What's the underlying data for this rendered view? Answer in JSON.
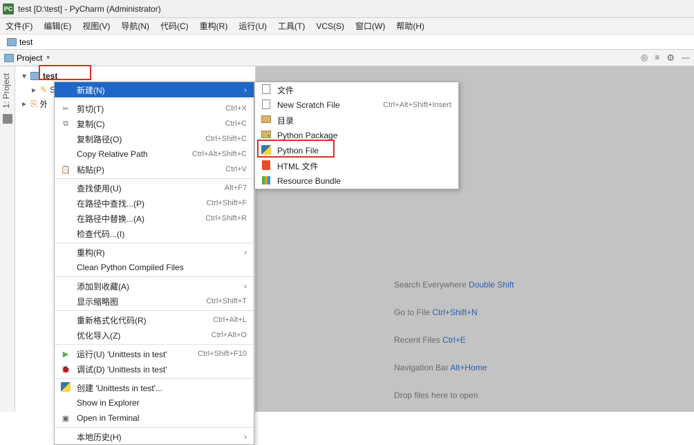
{
  "title": "test [D:\\test] - PyCharm (Administrator)",
  "menubar": [
    "文件(F)",
    "编辑(E)",
    "视图(V)",
    "导航(N)",
    "代码(C)",
    "重构(R)",
    "运行(U)",
    "工具(T)",
    "VCS(S)",
    "窗口(W)",
    "帮助(H)"
  ],
  "breadcrumb": "test",
  "projectPane": {
    "title": "Project"
  },
  "sideTab": {
    "label": "1: Project"
  },
  "tree": {
    "root": {
      "name": "test",
      "path": "D:\\test"
    },
    "scratches": "Scratches and Consoles",
    "external": "外部库"
  },
  "ctx": [
    {
      "ic": "",
      "lbl": "新建(N)",
      "sub": "›",
      "sel": true
    },
    {
      "sep": true
    },
    {
      "ic": "✂",
      "lbl": "剪切(T)",
      "sc": "Ctrl+X"
    },
    {
      "ic": "⧉",
      "lbl": "复制(C)",
      "sc": "Ctrl+C"
    },
    {
      "ic": "",
      "lbl": "复制路径(O)",
      "sc": "Ctrl+Shift+C"
    },
    {
      "ic": "",
      "lbl": "Copy Relative Path",
      "sc": "Ctrl+Alt+Shift+C"
    },
    {
      "ic": "📋",
      "lbl": "粘贴(P)",
      "sc": "Ctrl+V"
    },
    {
      "sep": true
    },
    {
      "ic": "",
      "lbl": "查找使用(U)",
      "sc": "Alt+F7"
    },
    {
      "ic": "",
      "lbl": "在路径中查找...(P)",
      "sc": "Ctrl+Shift+F"
    },
    {
      "ic": "",
      "lbl": "在路径中替换...(A)",
      "sc": "Ctrl+Shift+R"
    },
    {
      "ic": "",
      "lbl": "检查代码...(I)"
    },
    {
      "sep": true
    },
    {
      "ic": "",
      "lbl": "重构(R)",
      "sub": "›"
    },
    {
      "ic": "",
      "lbl": "Clean Python Compiled Files"
    },
    {
      "sep": true
    },
    {
      "ic": "",
      "lbl": "添加到收藏(A)",
      "sub": "›"
    },
    {
      "ic": "",
      "lbl": "显示缩略图",
      "sc": "Ctrl+Shift+T"
    },
    {
      "sep": true
    },
    {
      "ic": "",
      "lbl": "重新格式化代码(R)",
      "sc": "Ctrl+Alt+L"
    },
    {
      "ic": "",
      "lbl": "优化导入(Z)",
      "sc": "Ctrl+Alt+O"
    },
    {
      "sep": true
    },
    {
      "ic": "▶",
      "lbl": "运行(U) 'Unittests in test'",
      "sc": "Ctrl+Shift+F10",
      "icColor": "#4caf50"
    },
    {
      "ic": "🐞",
      "lbl": "调试(D) 'Unittests in test'"
    },
    {
      "sep": true
    },
    {
      "ic": "py",
      "lbl": "创建 'Unittests in test'..."
    },
    {
      "ic": "",
      "lbl": "Show in Explorer"
    },
    {
      "ic": "▣",
      "lbl": "Open in Terminal"
    },
    {
      "sep": true
    },
    {
      "ic": "",
      "lbl": "本地历史(H)",
      "sub": "›"
    }
  ],
  "submenu": [
    {
      "t": "file",
      "lbl": "文件"
    },
    {
      "t": "file",
      "lbl": "New Scratch File",
      "sc": "Ctrl+Alt+Shift+Insert"
    },
    {
      "t": "fold",
      "lbl": "目录"
    },
    {
      "t": "pkg",
      "lbl": "Python Package"
    },
    {
      "t": "py",
      "lbl": "Python File"
    },
    {
      "t": "html",
      "lbl": "HTML 文件"
    },
    {
      "t": "res",
      "lbl": "Resource Bundle"
    }
  ],
  "hints": [
    {
      "pre": "Search Everywhere ",
      "key": "Double Shift"
    },
    {
      "pre": "Go to File ",
      "key": "Ctrl+Shift+N"
    },
    {
      "pre": "Recent Files ",
      "key": "Ctrl+E"
    },
    {
      "pre": "Navigation Bar ",
      "key": "Alt+Home"
    },
    {
      "pre": "Drop files here to open",
      "key": ""
    }
  ],
  "toolIcons": {
    "target": "◎",
    "filter": "≡",
    "gear": "⚙",
    "collapse": "—"
  }
}
